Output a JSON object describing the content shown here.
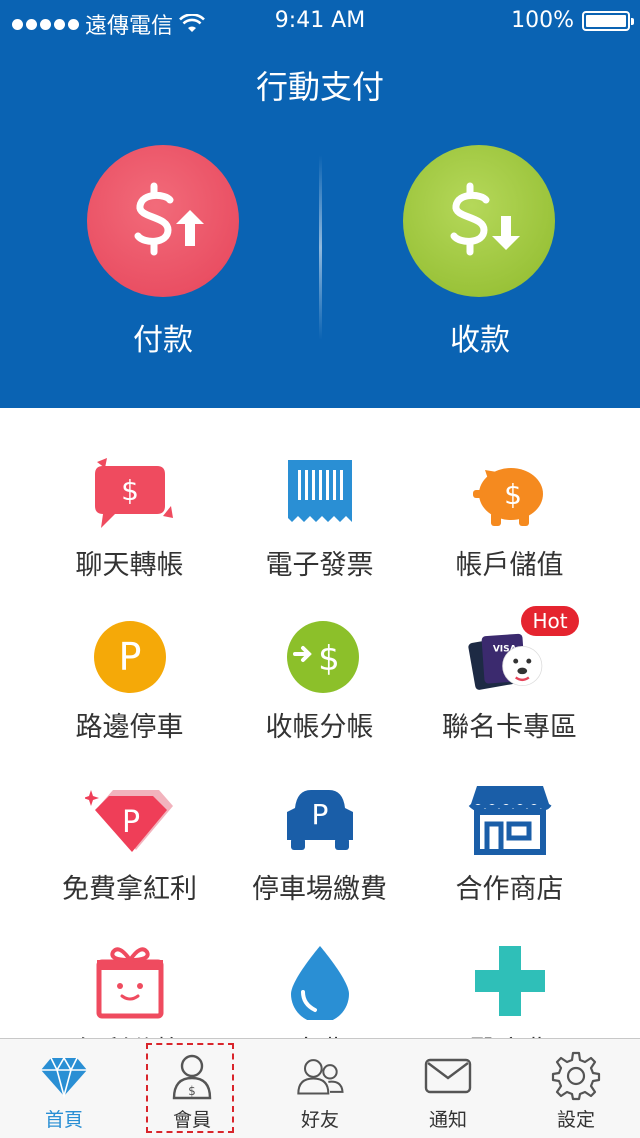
{
  "status_bar": {
    "carrier": "遠傳電信",
    "time": "9:41 AM",
    "battery": "100%"
  },
  "header": {
    "title": "行動支付"
  },
  "payment": {
    "pay_label": "付款",
    "receive_label": "收款",
    "pay_color": "#e6445a",
    "receive_color": "#8fba2c"
  },
  "services": [
    {
      "label": "聊天轉帳",
      "icon": "chat-transfer-icon"
    },
    {
      "label": "電子發票",
      "icon": "receipt-icon"
    },
    {
      "label": "帳戶儲值",
      "icon": "piggy-bank-icon"
    },
    {
      "label": "路邊停車",
      "icon": "parking-coin-icon"
    },
    {
      "label": "收帳分帳",
      "icon": "split-bill-icon"
    },
    {
      "label": "聯名卡專區",
      "icon": "co-brand-card-icon",
      "badge": "Hot"
    },
    {
      "label": "免費拿紅利",
      "icon": "bonus-diamond-icon"
    },
    {
      "label": "停車場繳費",
      "icon": "parking-car-icon"
    },
    {
      "label": "合作商店",
      "icon": "store-icon"
    },
    {
      "label": "紅利兌換",
      "icon": "gift-icon"
    },
    {
      "label": "水費",
      "icon": "water-drop-icon"
    },
    {
      "label": "醫療費",
      "icon": "medical-cross-icon"
    }
  ],
  "tabbar": {
    "items": [
      {
        "label": "首頁",
        "icon": "diamond-icon",
        "active": true
      },
      {
        "label": "會員",
        "icon": "member-icon",
        "active": false
      },
      {
        "label": "好友",
        "icon": "friends-icon",
        "active": false
      },
      {
        "label": "通知",
        "icon": "mail-icon",
        "active": false
      },
      {
        "label": "設定",
        "icon": "gear-icon",
        "active": false
      }
    ]
  },
  "colors": {
    "header_blue": "#0a63b3",
    "active_tab": "#2a8fd4",
    "highlight": "#d9252b"
  }
}
